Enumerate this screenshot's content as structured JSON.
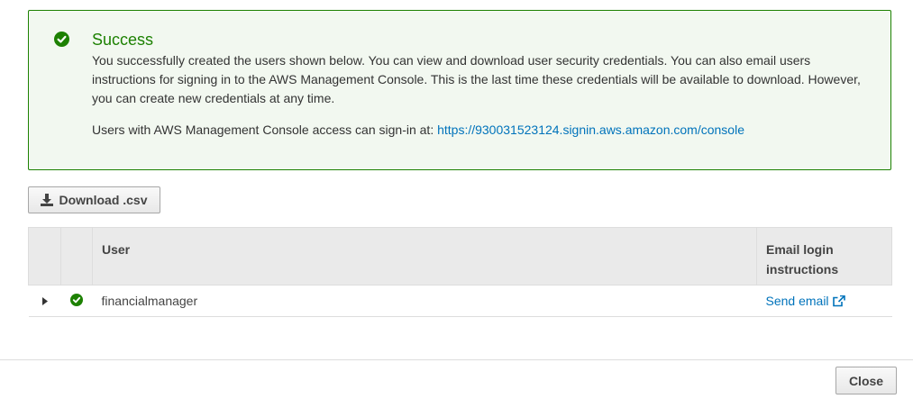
{
  "alert": {
    "title": "Success",
    "body": "You successfully created the users shown below. You can view and download user security credentials. You can also email users instructions for signing in to the AWS Management Console. This is the last time these credentials will be available to download. However, you can create new credentials at any time.",
    "signin_label": "Users with AWS Management Console access can sign-in at: ",
    "signin_url": "https://930031523124.signin.aws.amazon.com/console",
    "color": "#1d8102"
  },
  "toolbar": {
    "download_label": "Download .csv"
  },
  "table": {
    "headers": {
      "user": "User",
      "email_line1": "Email login",
      "email_line2": "instructions"
    },
    "rows": [
      {
        "user": "financialmanager",
        "status": "success",
        "email_action": "Send email"
      }
    ]
  },
  "footer": {
    "close_label": "Close"
  },
  "colors": {
    "link": "#0073bb",
    "success": "#1d8102"
  }
}
